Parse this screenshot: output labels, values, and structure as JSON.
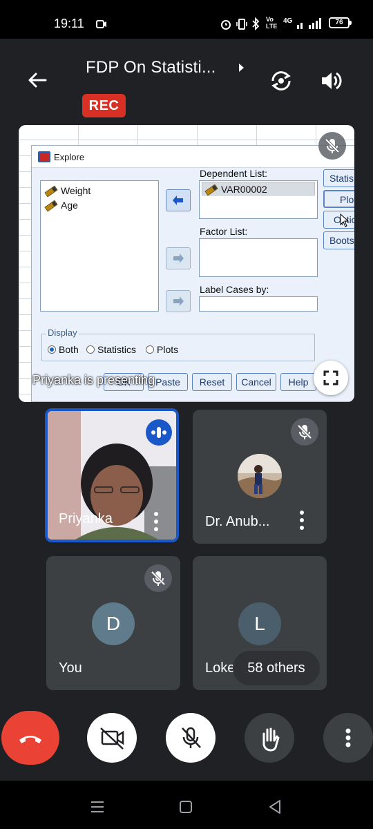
{
  "status_bar": {
    "time": "19:11",
    "battery": "76",
    "network_label": "4G"
  },
  "header": {
    "title": "FDP On Statisti...",
    "rec_badge": "REC"
  },
  "presentation": {
    "presenting_label": "Priyanka is presenting",
    "dialog": {
      "title": "Explore",
      "source_variables": [
        "Weight",
        "Age"
      ],
      "dependent_list_label": "Dependent List:",
      "dependent_list_items": [
        "VAR00002"
      ],
      "factor_list_label": "Factor List:",
      "label_cases_label": "Label Cases by:",
      "side_buttons": [
        "Statis",
        "Plot",
        "Optio",
        "Boots"
      ],
      "display_label": "Display",
      "display_options": [
        "Both",
        "Statistics",
        "Plots"
      ],
      "display_selected": "Both",
      "buttons": [
        "OK",
        "Paste",
        "Reset",
        "Cancel",
        "Help"
      ]
    }
  },
  "participants": [
    {
      "name": "Priyanka",
      "speaking": true
    },
    {
      "name": "Dr. Anub...",
      "muted": true
    },
    {
      "name": "You",
      "avatar_letter": "D",
      "muted": true,
      "avatar_color": "#5f7b8c"
    },
    {
      "name": "Lokesh",
      "avatar_letter": "L",
      "avatar_color": "#4a5f6b"
    }
  ],
  "others_chip": "58 others",
  "colors": {
    "background": "#202124",
    "rec_red": "#d93025",
    "end_call_red": "#ea4335",
    "active_speaker_blue": "#1a57c9"
  },
  "controls": [
    "end-call",
    "camera-off",
    "mic-off",
    "raise-hand",
    "more-options"
  ]
}
